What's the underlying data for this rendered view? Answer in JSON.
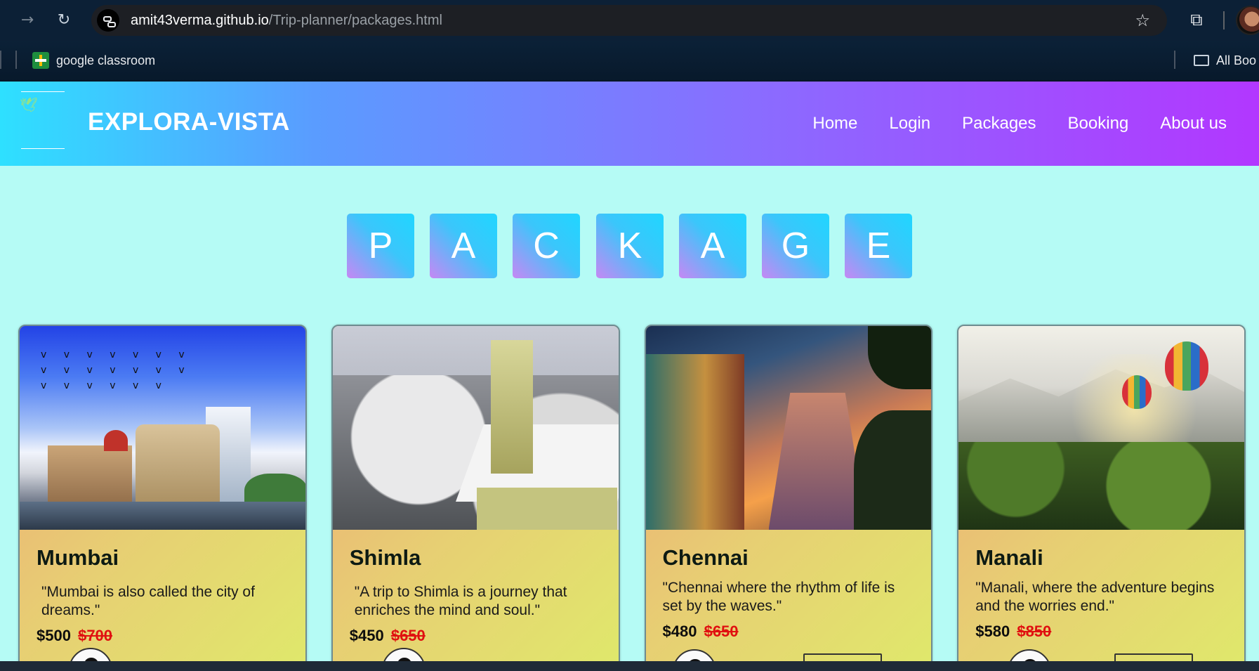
{
  "browser": {
    "url_domain": "amit43verma.github.io",
    "url_path": "/Trip-planner/packages.html",
    "icons": [
      "back-arrow-icon",
      "reload-icon",
      "site-info-icon",
      "star-icon",
      "extensions-icon",
      "profile-avatar"
    ]
  },
  "bookmarks": {
    "items": [
      {
        "label": "google classroom",
        "icon": "google-classroom-icon"
      }
    ],
    "all_bookmarks_label": "All Boo"
  },
  "site": {
    "brand": "EXPLORA-VISTA",
    "nav": [
      "Home",
      "Login",
      "Packages",
      "Booking",
      "About us"
    ],
    "colors": {
      "header_start": "#2ee0ff",
      "header_end": "#b237ff",
      "page_bg": "#b5fbf5"
    }
  },
  "title_letters": [
    "P",
    "A",
    "C",
    "K",
    "A",
    "G",
    "E"
  ],
  "packages": [
    {
      "name": "Mumbai",
      "description": "\"Mumbai is also called the city of dreams.\"",
      "price": "$500",
      "old_price": "$700"
    },
    {
      "name": "Shimla",
      "description": "\"A trip to Shimla is a journey that enriches the mind and soul.\"",
      "price": "$450",
      "old_price": "$650"
    },
    {
      "name": "Chennai",
      "description": "\"Chennai where the rhythm of life is set by the waves.\"",
      "price": "$480",
      "old_price": "$650"
    },
    {
      "name": "Manali",
      "description": "\"Manali, where the adventure begins and the worries end.\"",
      "price": "$580",
      "old_price": "$850"
    }
  ]
}
